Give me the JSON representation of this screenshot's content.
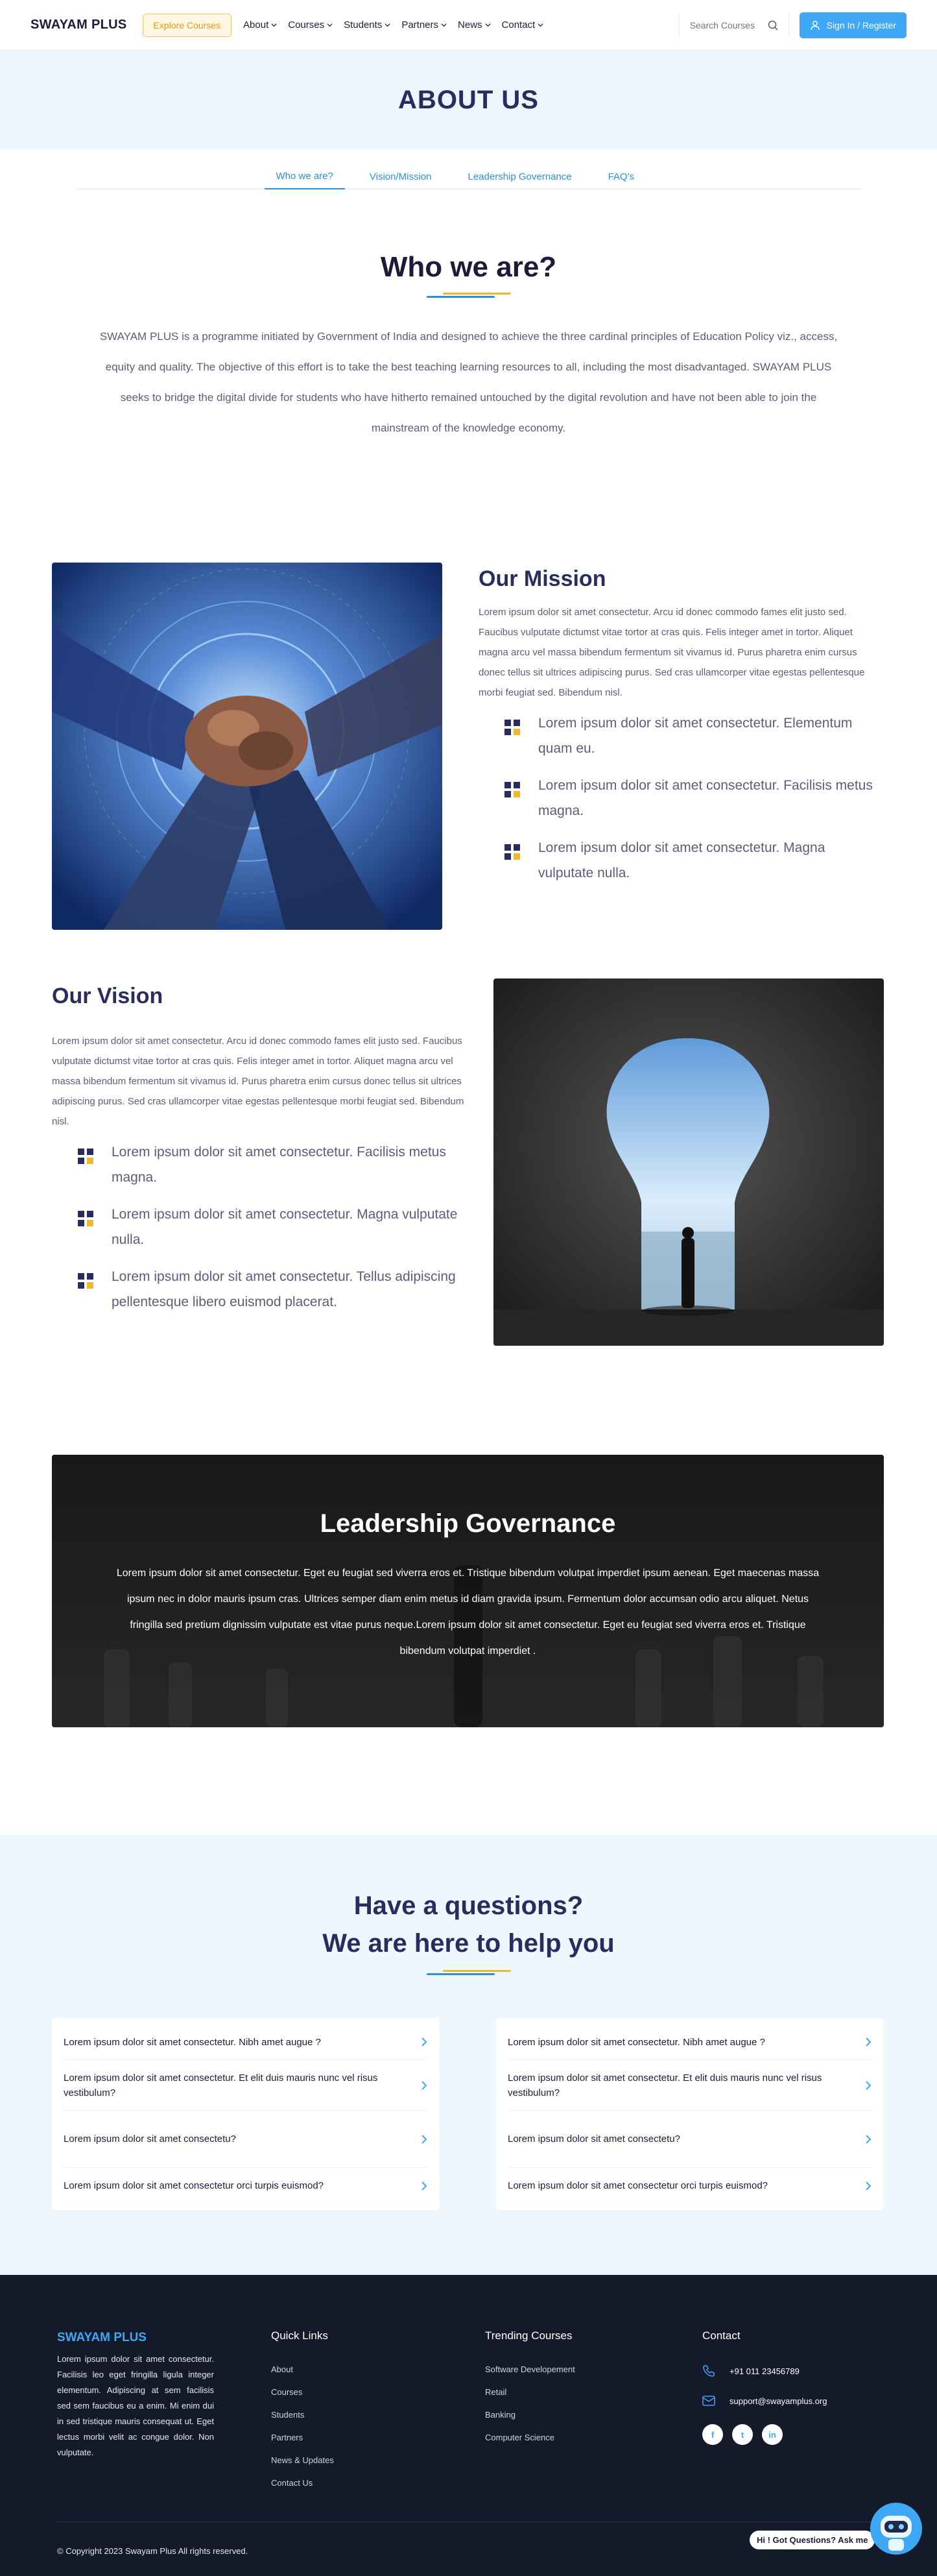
{
  "header": {
    "logo": "SWAYAM PLUS",
    "explore": "Explore Courses",
    "nav": [
      "About",
      "Courses",
      "Students",
      "Partners",
      "News",
      "Contact"
    ],
    "search_placeholder": "Search Courses",
    "signin": "Sign In / Register"
  },
  "hero": {
    "title": "ABOUT US"
  },
  "tabs": [
    "Who we are?",
    "Vision/Mission",
    "Leadership Governance",
    "FAQ's"
  ],
  "who": {
    "title": "Who we are?",
    "text": "SWAYAM PLUS is a programme initiated by Government of India and designed to achieve the three cardinal principles of Education Policy viz., access, equity and quality. The objective of this effort is to take the best teaching learning resources to all, including the most disadvantaged. SWAYAM PLUS seeks to bridge the digital divide for students who have hitherto remained untouched by the digital revolution and have not been able to join the mainstream of the knowledge economy."
  },
  "mission": {
    "title": "Our Mission",
    "text": "Lorem ipsum dolor sit amet consectetur. Arcu id donec commodo fames elit justo sed. Faucibus vulputate dictumst vitae tortor at cras quis. Felis integer amet in tortor. Aliquet magna arcu vel massa bibendum fermentum sit vivamus id. Purus pharetra enim cursus donec tellus sit ultrices adipiscing purus. Sed cras ullamcorper vitae egestas pellentesque morbi feugiat sed. Bibendum nisl.",
    "points": [
      "Lorem ipsum dolor sit amet consectetur. Elementum quam eu.",
      "Lorem ipsum dolor sit amet consectetur. Facilisis metus magna.",
      "Lorem ipsum dolor sit amet consectetur. Magna vulputate nulla."
    ]
  },
  "vision": {
    "title": "Our Vision",
    "text": "Lorem ipsum dolor sit amet consectetur. Arcu id donec commodo fames elit justo sed. Faucibus vulputate dictumst vitae tortor at cras quis. Felis integer amet in tortor. Aliquet magna arcu vel massa bibendum fermentum sit vivamus id. Purus pharetra enim cursus donec tellus sit ultrices adipiscing purus. Sed cras ullamcorper vitae egestas pellentesque morbi feugiat sed. Bibendum nisl.",
    "points": [
      "Lorem ipsum dolor sit amet consectetur. Facilisis metus magna.",
      "Lorem ipsum dolor sit amet consectetur. Magna vulputate nulla.",
      "Lorem ipsum dolor sit amet consectetur. Tellus adipiscing pellentesque libero euismod placerat."
    ]
  },
  "leadership": {
    "title": "Leadership Governance",
    "text": "Lorem ipsum dolor sit amet consectetur. Eget eu feugiat sed viverra eros et. Tristique bibendum volutpat imperdiet ipsum aenean. Eget maecenas massa ipsum nec in dolor mauris ipsum cras. Ultrices semper diam enim metus id diam gravida ipsum. Fermentum dolor accumsan odio arcu aliquet. Netus fringilla sed pretium dignissim vulputate est vitae purus neque.Lorem ipsum dolor sit amet consectetur. Eget eu feugiat sed viverra eros et. Tristique bibendum volutpat imperdiet ."
  },
  "faq": {
    "title_line1": "Have a questions?",
    "title_line2": "We are here to help you",
    "left": [
      "Lorem ipsum dolor sit amet consectetur. Nibh amet augue ?",
      "Lorem ipsum dolor sit amet consectetur. Et elit duis mauris nunc vel risus vestibulum?",
      "Lorem ipsum dolor sit amet consectetu?",
      "Lorem ipsum dolor sit amet consectetur orci turpis euismod?"
    ],
    "right": [
      "Lorem ipsum dolor sit amet consectetur. Nibh amet augue ?",
      "Lorem ipsum dolor sit amet consectetur. Et elit duis mauris nunc vel risus vestibulum?",
      "Lorem ipsum dolor sit amet consectetu?",
      "Lorem ipsum dolor sit amet consectetur orci turpis euismod?"
    ]
  },
  "footer": {
    "brand": "SWAYAM PLUS",
    "about": "Lorem ipsum dolor sit amet consectetur. Facilisis leo eget fringilla ligula integer elementum. Adipiscing at sem facilisis sed sem faucibus eu a enim. Mi enim dui in sed tristique mauris consequat ut. Eget lectus morbi velit ac congue dolor. Non vulputate.",
    "quick_links_title": "Quick Links",
    "quick_links": [
      "About",
      "Courses",
      "Students",
      "Partners",
      "News & Updates",
      "Contact Us"
    ],
    "trending_title": "Trending Courses",
    "trending": [
      "Software Developement",
      "Retail",
      "Banking",
      "Computer Science"
    ],
    "contact_title": "Contact",
    "phone": "+91 011 23456789",
    "email": "support@swayamplus.org",
    "social": [
      "f",
      "t",
      "in"
    ],
    "copyright": "© Copyright 2023  Swayam Plus  All rights reserved.",
    "chat": "Hi ! Got Questions? Ask me"
  },
  "colors": {
    "accent": "#3ea8f5",
    "navy": "#2a2c5e",
    "gold": "#f2b731"
  },
  "icons": {
    "search": "search-icon",
    "user": "user-icon",
    "chevron": "chevron-down-icon",
    "faq_toggle": "chevron-right-icon",
    "phone": "phone-icon",
    "email": "mail-icon"
  }
}
